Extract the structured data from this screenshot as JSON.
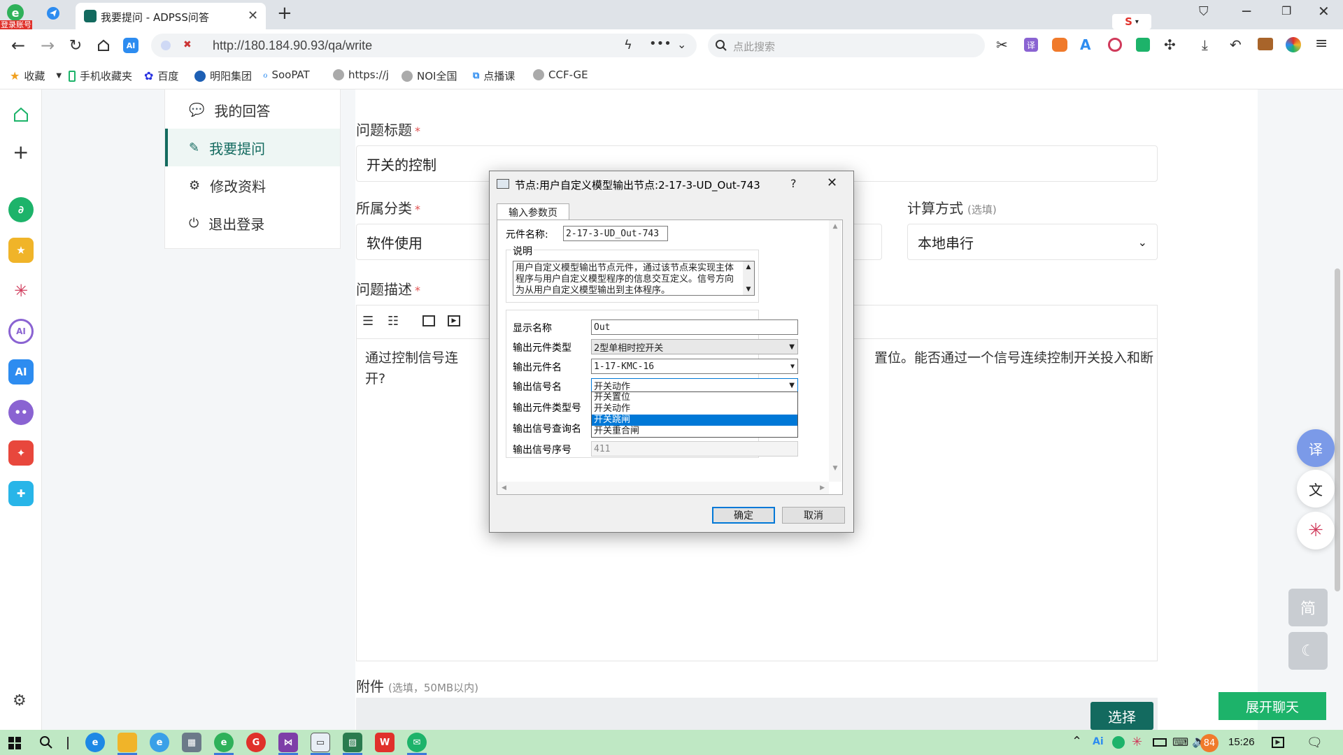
{
  "browser": {
    "badge_label": "登录账号",
    "tab_title": "我要提问 - ADPSS问答",
    "url": "http://180.184.90.93/qa/write",
    "search_placeholder": "点此搜索",
    "bookmarks": [
      "收藏",
      "手机收藏夹",
      "百度",
      "明阳集团",
      "SooPAT",
      "https://j",
      "NOI全国",
      "点播课",
      "CCF-GE"
    ]
  },
  "sidebar": {
    "items": [
      {
        "label": "我的回答",
        "icon": "comment-icon"
      },
      {
        "label": "我要提问",
        "icon": "edit-icon",
        "active": true
      },
      {
        "label": "修改资料",
        "icon": "gear-icon"
      },
      {
        "label": "退出登录",
        "icon": "power-icon"
      }
    ]
  },
  "form": {
    "title_label": "问题标题",
    "title_value": "开关的控制",
    "category_label": "所属分类",
    "category_value": "软件使用",
    "calc_label": "计算方式",
    "calc_optional": "(选填)",
    "calc_value": "本地串行",
    "desc_label": "问题描述",
    "desc_text_line1_start": "通过控制信号连",
    "desc_text_line1_end": "置位。能否通过一个信号连续控制开关投入和断",
    "desc_text_line2": "开?",
    "attach_label": "附件",
    "attach_hint": "(选填，50MB以内)",
    "choose_button": "选择",
    "required_mark": "*"
  },
  "dialog": {
    "title": "节点:用户自定义模型输出节点:2-17-3-UD_Out-743",
    "help_label": "?",
    "tab_label": "输入参数页",
    "element_name_label": "元件名称:",
    "element_name_value": "2-17-3-UD_Out-743",
    "desc_group_label": "说明",
    "desc_text": "用户自定义模型输出节点元件，通过该节点来实现主体程序与用户自定义模型程序的信息交互定义。信号方向为从用户自定义模型输出到主体程序。",
    "display_name_label": "显示名称",
    "display_name_value": "Out",
    "output_type_label": "输出元件类型",
    "output_type_value": "2型单相时控开关",
    "output_element_label": "输出元件名",
    "output_element_value": "1-17-KMC-16",
    "signal_name_label": "输出信号名",
    "signal_name_value": "开关动作",
    "type_no_label": "输出元件类型号",
    "query_name_label": "输出信号查询名",
    "serial_label": "输出信号序号",
    "serial_value": "411",
    "dropdown_options": [
      "开关置位",
      "开关动作",
      "开关跳闸",
      "开关重合闸"
    ],
    "dropdown_selected_index": 2,
    "ok_button": "确定",
    "cancel_button": "取消"
  },
  "right_panel": {
    "translate_label": "译",
    "simplified_label": "简",
    "expand_chat": "展开聊天"
  },
  "taskbar": {
    "clock": "15:26",
    "notif_count": "84"
  },
  "colors": {
    "brand": "#136a5f",
    "chat_green": "#1db36a",
    "selection_blue": "#0078d7",
    "taskbar": "#bfe8c4"
  }
}
